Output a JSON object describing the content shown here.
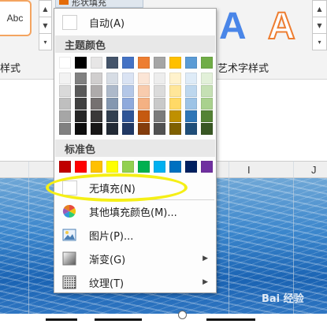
{
  "ribbon": {
    "style_sample": "Abc",
    "left_group_label": "样式",
    "right_group_label": "艺术字样式",
    "shape_fill_label": "形状填充",
    "wordart_glyph": "A",
    "col_letters": [
      "I",
      "J"
    ]
  },
  "menu": {
    "automatic": "自动(A)",
    "theme_colors_header": "主题颜色",
    "standard_colors_header": "标准色",
    "no_fill": "无填充(N)",
    "more_colors": "其他填充颜色(M)...",
    "picture": "图片(P)...",
    "gradient": "渐变(G)",
    "texture": "纹理(T)",
    "submenu_arrow": "▶",
    "theme_top_row": [
      "#ffffff",
      "#000000",
      "#e7e6e6",
      "#44546a",
      "#4472c4",
      "#ed7d31",
      "#a5a5a5",
      "#ffc000",
      "#5b9bd5",
      "#70ad47"
    ],
    "theme_shades": [
      [
        "#f2f2f2",
        "#808080",
        "#d0cece",
        "#d6dce4",
        "#dae3f3",
        "#fbe5d6",
        "#ededed",
        "#fff2cc",
        "#deebf7",
        "#e2f0d9"
      ],
      [
        "#d9d9d9",
        "#595959",
        "#aeabab",
        "#adb9ca",
        "#b4c7e7",
        "#f8cbad",
        "#dbdbdb",
        "#ffe699",
        "#bdd7ee",
        "#c5e0b4"
      ],
      [
        "#bfbfbf",
        "#404040",
        "#757171",
        "#8497b0",
        "#8faadc",
        "#f4b183",
        "#c9c9c9",
        "#ffd966",
        "#9dc3e6",
        "#a9d18e"
      ],
      [
        "#a6a6a6",
        "#262626",
        "#3a3838",
        "#323f4f",
        "#2f5597",
        "#c55a11",
        "#7b7b7b",
        "#bf9000",
        "#2e75b6",
        "#548235"
      ],
      [
        "#808080",
        "#0d0d0d",
        "#171616",
        "#222a35",
        "#203864",
        "#843c0c",
        "#525252",
        "#7f6000",
        "#1f4e79",
        "#385723"
      ]
    ],
    "standard": [
      "#c00000",
      "#ff0000",
      "#ffc000",
      "#ffff00",
      "#92d050",
      "#00b050",
      "#00b0f0",
      "#0070c0",
      "#002060",
      "#7030a0"
    ]
  },
  "watermark": {
    "text": "Bai 经验"
  },
  "icons": {
    "more_colors": "color-wheel-icon",
    "picture": "picture-icon",
    "gradient": "gradient-icon",
    "texture": "texture-icon"
  },
  "colors": {
    "highlight_ellipse": "#f5ef16",
    "menu_header_bg": "#e8e8e8"
  }
}
